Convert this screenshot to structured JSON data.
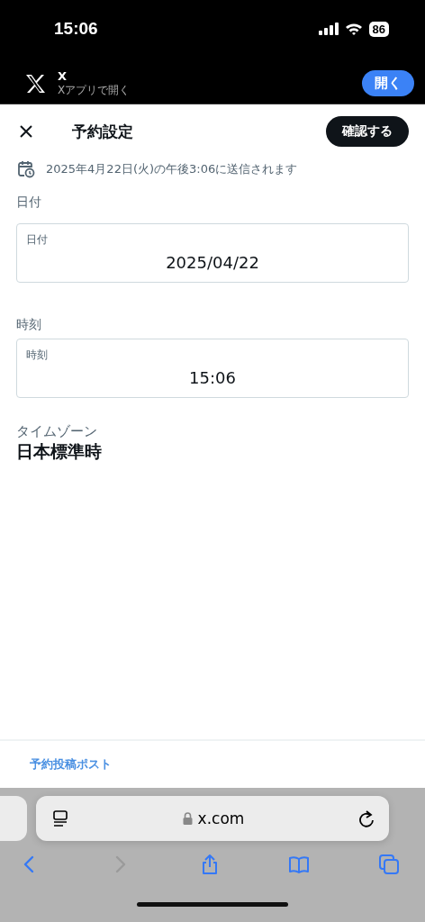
{
  "status_bar": {
    "time": "15:06",
    "battery": "86"
  },
  "app_banner": {
    "name": "X",
    "subtitle": "Xアプリで開く",
    "button": "開く"
  },
  "header": {
    "title": "予約設定",
    "confirm": "確認する"
  },
  "notice": "2025年4月22日(火)の午後3:06に送信されます",
  "fields": [
    {
      "section": "日付",
      "label": "日付",
      "value": "2025/04/22"
    },
    {
      "section": "時刻",
      "label": "時刻",
      "value": "15:06"
    }
  ],
  "timezone": {
    "label": "タイムゾーン",
    "value": "日本標準時"
  },
  "footer_link": "予約投稿ポスト",
  "browser": {
    "url": "x.com",
    "toolbar": [
      {
        "kind": "back",
        "disabled": false
      },
      {
        "kind": "forward",
        "disabled": true
      },
      {
        "kind": "share",
        "disabled": false
      },
      {
        "kind": "bookmarks",
        "disabled": false
      },
      {
        "kind": "tabs",
        "disabled": false
      }
    ]
  }
}
